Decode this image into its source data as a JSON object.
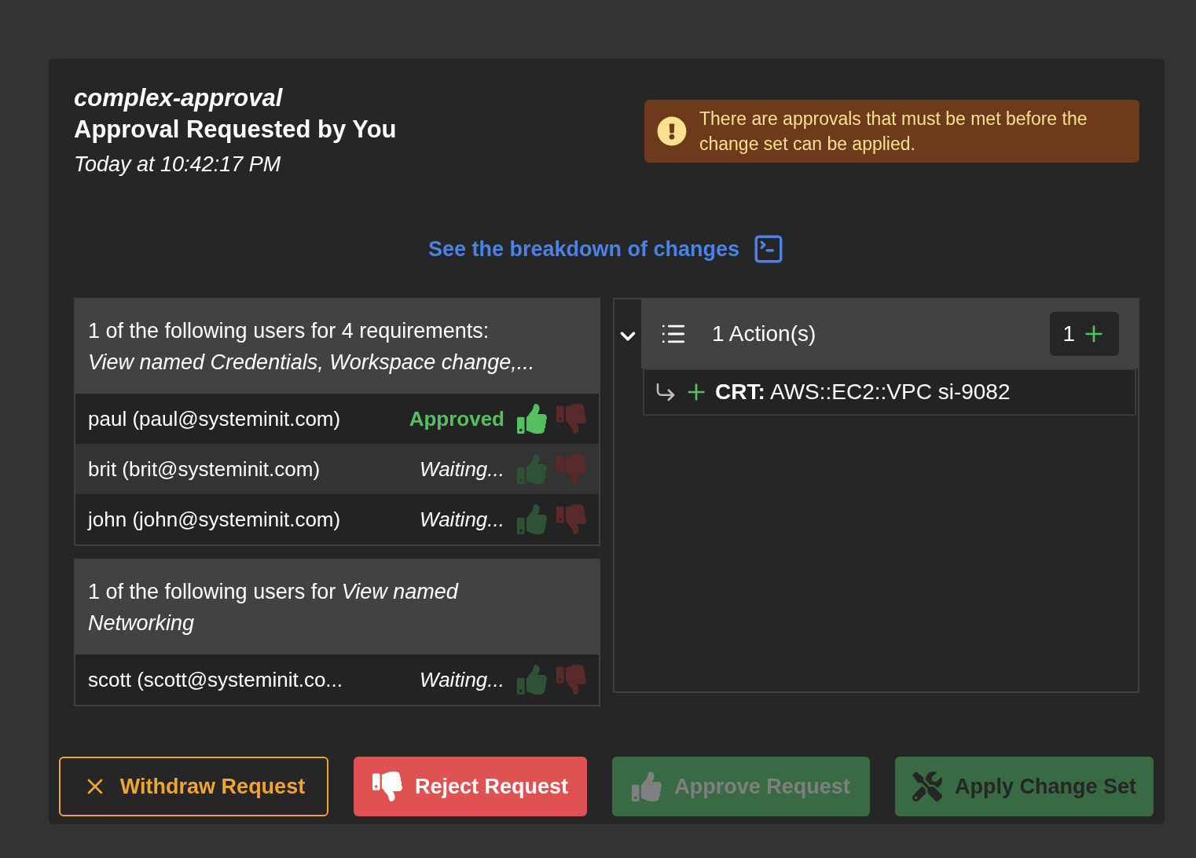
{
  "header": {
    "name": "complex-approval",
    "title": "Approval Requested by You",
    "time": "Today at 10:42:17 PM"
  },
  "warning": {
    "text": "There are approvals that must be met before the change set can be applied."
  },
  "breakdown_link": {
    "label": "See the breakdown of changes"
  },
  "requirement_groups": [
    {
      "text": "1 of the following users for 4 requirements:\n*View named Credentials, Workspace change,...*",
      "users": [
        {
          "name": "paul (paul@systeminit.com)",
          "status": "Approved",
          "kind": "approved"
        },
        {
          "name": "brit (brit@systeminit.com)",
          "status": "Waiting...",
          "kind": "waiting"
        },
        {
          "name": "john (john@systeminit.com)",
          "status": "Waiting...",
          "kind": "waiting"
        }
      ]
    },
    {
      "text": "1 of the following users for *View named*\n*Networking*",
      "users": [
        {
          "name": "scott (scott@systeminit.co...",
          "status": "Waiting...",
          "kind": "waiting"
        }
      ]
    }
  ],
  "actions": {
    "title": "1 Action(s)",
    "count": "1",
    "expanded": true,
    "items": [
      {
        "text": "**CRT:** AWS::EC2::VPC si-9082"
      }
    ]
  },
  "buttons": [
    {
      "label": "Withdraw Request",
      "kind": "withdraw",
      "disabled": false
    },
    {
      "label": "Reject Request",
      "kind": "reject",
      "disabled": false
    },
    {
      "label": "Approve Request",
      "kind": "approve",
      "disabled": true
    },
    {
      "label": "Apply Change Set",
      "kind": "apply",
      "disabled": false
    }
  ]
}
